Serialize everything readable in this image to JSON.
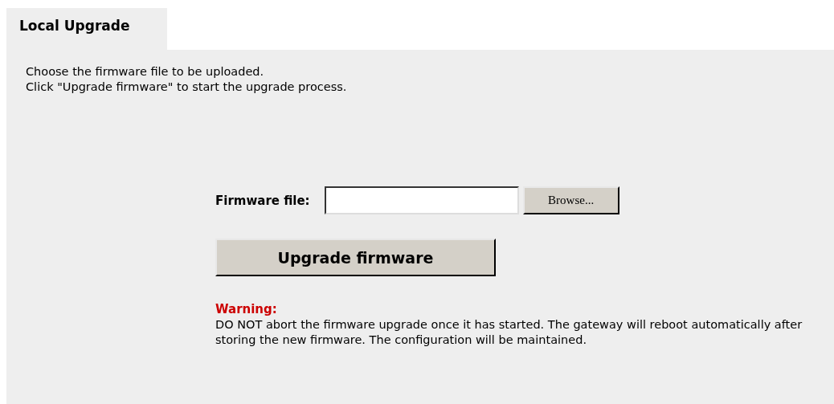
{
  "tab": {
    "label": "Local Upgrade",
    "selected": true
  },
  "intro": [
    "Choose the firmware file to be uploaded.",
    "Click \"Upgrade firmware\" to start the upgrade process."
  ],
  "firmware_field": {
    "label": "Firmware file:",
    "browse_button": "Browse..."
  },
  "upgrade_button": "Upgrade firmware",
  "warning": {
    "title": "Warning:",
    "text": "DO NOT abort the firmware upgrade once it has started. The gateway will reboot automatically after storing the new firmware. The configuration will be maintained."
  }
}
